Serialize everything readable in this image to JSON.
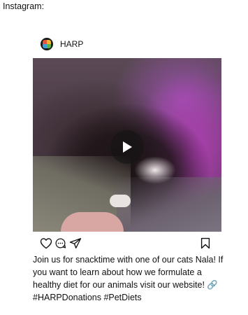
{
  "heading": "Instagram:",
  "post": {
    "username": "HARP",
    "media": {
      "kind": "video",
      "play_icon": "play-icon"
    },
    "actions": {
      "like_icon": "heart-icon",
      "comment_icon": "comment-icon",
      "share_icon": "send-icon",
      "save_icon": "bookmark-icon"
    },
    "caption": "Join us for snacktime with one of our cats Nala! If you want to learn about how we formulate a healthy diet for our animals visit our website! 🔗 #HARPDonations #PetDiets"
  },
  "colors": {
    "background": "#ffffff",
    "text": "#111111",
    "play_overlay": "#141414"
  }
}
